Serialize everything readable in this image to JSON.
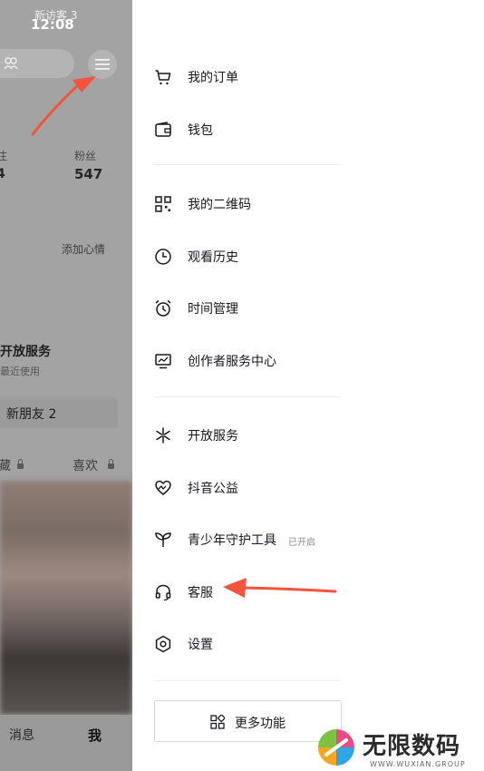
{
  "status_bar": {
    "time": "12:08"
  },
  "profile": {
    "visitors_label": "新访客 3",
    "follow_label": "注",
    "follow_value": "4",
    "fans_label": "粉丝",
    "fans_value": "547",
    "add_mood": "添加心情",
    "open_service_title": "开放服务",
    "open_service_sub": "最近使用",
    "new_friends": "新朋友 2",
    "tab_favorites": "藏",
    "tab_likes": "喜欢"
  },
  "bottom_nav": {
    "messages": "消息",
    "me": "我"
  },
  "drawer": {
    "groups": [
      {
        "items": [
          {
            "icon": "cart-icon",
            "label": "我的订单"
          },
          {
            "icon": "wallet-icon",
            "label": "钱包"
          }
        ]
      },
      {
        "items": [
          {
            "icon": "qrcode-icon",
            "label": "我的二维码"
          },
          {
            "icon": "clock-icon",
            "label": "观看历史"
          },
          {
            "icon": "alarm-icon",
            "label": "时间管理"
          },
          {
            "icon": "monitor-chart-icon",
            "label": "创作者服务中心"
          }
        ]
      },
      {
        "items": [
          {
            "icon": "sparkle-icon",
            "label": "开放服务"
          },
          {
            "icon": "heart-icon",
            "label": "抖音公益"
          },
          {
            "icon": "sprout-icon",
            "label": "青少年守护工具",
            "badge": "已开启"
          },
          {
            "icon": "headset-icon",
            "label": "客服"
          },
          {
            "icon": "hexagon-settings-icon",
            "label": "设置"
          }
        ]
      }
    ],
    "more_button": {
      "icon": "grid-icon",
      "label": "更多功能"
    }
  },
  "watermark": {
    "text": "无限数码",
    "sub": "WWW.WUXIAN.GROUP"
  },
  "colors": {
    "arrow": "#f2553b",
    "dim_overlay": "#a3a3a3",
    "text": "#161823"
  }
}
